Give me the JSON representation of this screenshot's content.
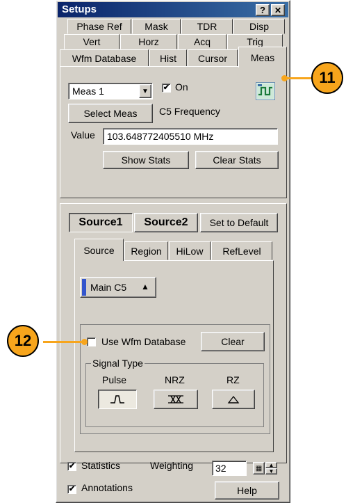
{
  "window": {
    "title": "Setups",
    "help_glyph": "?",
    "close_glyph": "✕"
  },
  "tabs": {
    "row1": [
      "Phase Ref",
      "Mask",
      "TDR",
      "Disp"
    ],
    "row2": [
      "Vert",
      "Horz",
      "Acq",
      "Trig"
    ],
    "row3": [
      "Wfm Database",
      "Hist",
      "Cursor",
      "Meas"
    ],
    "active": "Meas"
  },
  "meas": {
    "select_value": "Meas 1",
    "on_checked": true,
    "on_label": "On",
    "select_meas_label": "Select Meas",
    "meas_name": "C5 Frequency",
    "value_label": "Value",
    "value": "103.648772405510 MHz",
    "show_stats_label": "Show Stats",
    "clear_stats_label": "Clear Stats",
    "icon": "measurement-icon"
  },
  "source": {
    "source1_label": "Source1",
    "source2_label": "Source2",
    "set_default_label": "Set to Default",
    "subtabs": [
      "Source",
      "Region",
      "HiLow",
      "RefLevel"
    ],
    "active_subtab": "Source",
    "channel_label": "Main C5",
    "channel_color": "#3355cc",
    "use_wfm_db_checked": false,
    "use_wfm_db_label": "Use Wfm Database",
    "clear_label": "Clear",
    "signal_type_label": "Signal Type",
    "signal_types": [
      "Pulse",
      "NRZ",
      "RZ"
    ],
    "selected_signal_type": "Pulse"
  },
  "footer": {
    "statistics_checked": true,
    "statistics_label": "Statistics",
    "weighting_label": "Weighting",
    "weighting_value": "32",
    "annotations_checked": true,
    "annotations_label": "Annotations",
    "help_label": "Help"
  },
  "callouts": {
    "meas_tab": "11",
    "use_wfm_db": "12",
    "color": "#f7a51c"
  }
}
